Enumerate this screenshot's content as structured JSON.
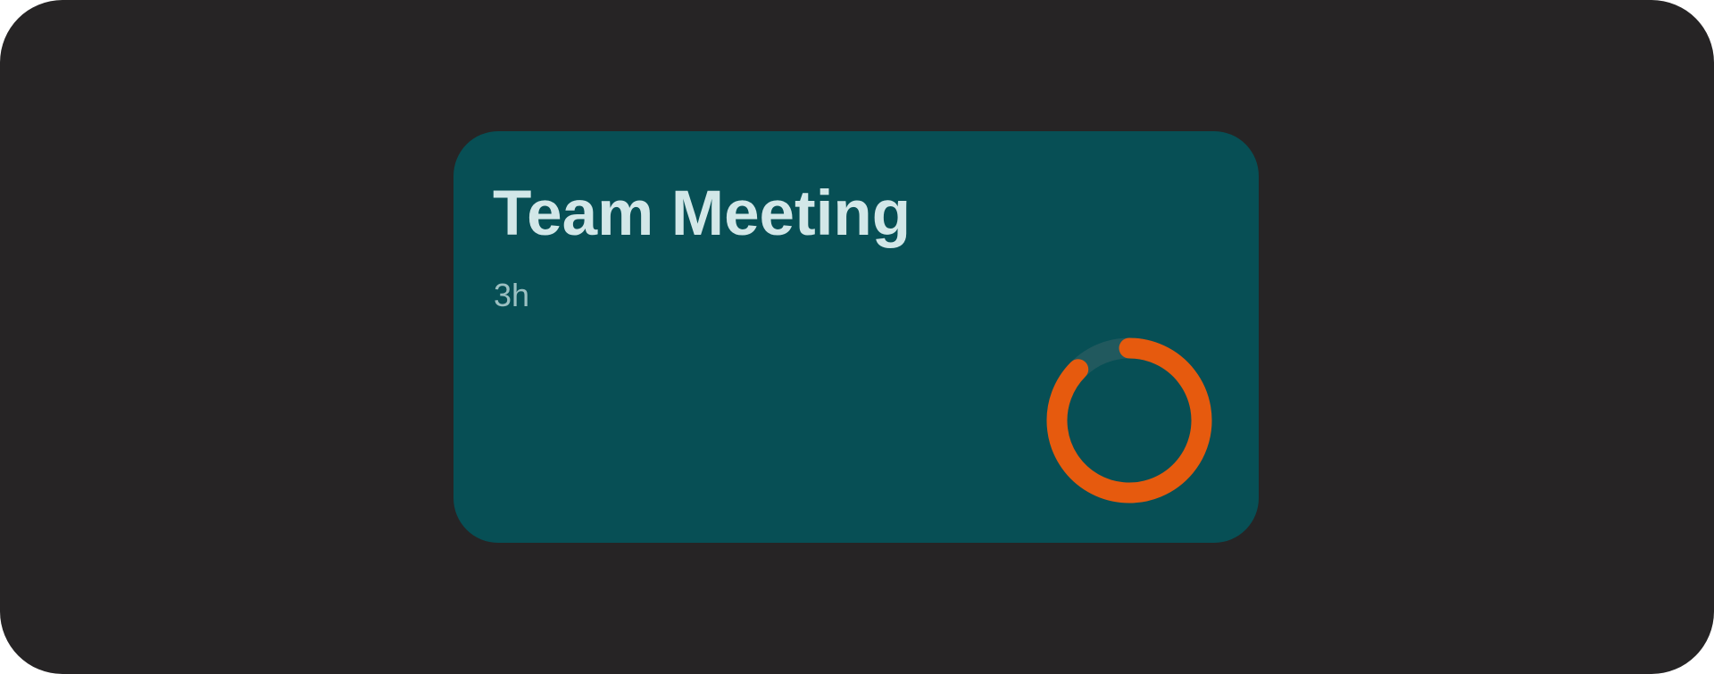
{
  "event": {
    "title": "Team Meeting",
    "duration": "3h"
  },
  "progress_ring": {
    "fraction": 0.875,
    "start_angle_deg": 0,
    "track_color": "#21595e",
    "fill_color": "#e65a0e"
  },
  "colors": {
    "background": "#262425",
    "card": "#074f55",
    "title_text": "#d2e7e8",
    "subtitle_text": "#9cc0c2"
  }
}
